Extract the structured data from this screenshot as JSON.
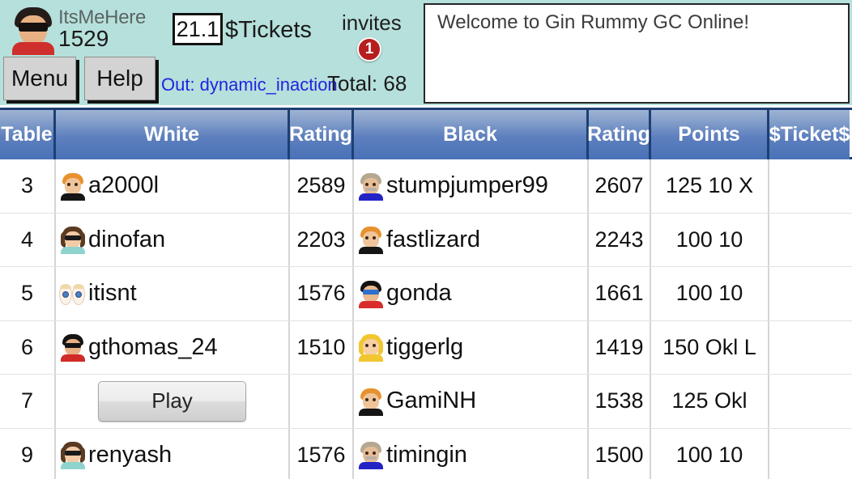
{
  "header": {
    "user": {
      "avatar_icon": "user-avatar-sunglasses-red",
      "name": "ItsMeHere",
      "rating": "1529"
    },
    "tickets": {
      "value": "21.1",
      "label": "$Tickets"
    },
    "invites": {
      "label": "invites",
      "count": "1"
    },
    "buttons": {
      "menu": "Menu",
      "help": "Help"
    },
    "out_status": "Out: dynamic_inaction",
    "total": "Total: 68",
    "chat": {
      "message": "Welcome to Gin Rummy GC Online!"
    }
  },
  "colors": {
    "top_bar_bg": "#b6e0dc",
    "header_row_blue": "#4a72b7",
    "header_row_border": "#1d3f73",
    "link_blue": "#2323e0",
    "badge_red": "#b81d1d"
  },
  "table": {
    "columns": [
      {
        "label": "Table"
      },
      {
        "label": "White"
      },
      {
        "label": "Rating"
      },
      {
        "label": "Black"
      },
      {
        "label": "Rating"
      },
      {
        "label": "Points"
      },
      {
        "label": "$Ticket$"
      }
    ],
    "rows": [
      {
        "table": "3",
        "white": {
          "name": "a2000l",
          "avatar_icon": "avatar-orange-hair-black-shirt"
        },
        "white_rating": "2589",
        "black": {
          "name": "stumpjumper99",
          "avatar_icon": "avatar-grey-hair-moustache-blue-shirt"
        },
        "black_rating": "2607",
        "points": "125 10 X",
        "ticket": ""
      },
      {
        "table": "4",
        "white": {
          "name": "dinofan",
          "avatar_icon": "avatar-brown-curly-sunglasses-teal-shirt"
        },
        "white_rating": "2203",
        "black": {
          "name": "fastlizard",
          "avatar_icon": "avatar-orange-hair-black-shirt"
        },
        "black_rating": "2243",
        "points": "100 10",
        "ticket": ""
      },
      {
        "table": "5",
        "white": {
          "name": "itisnt",
          "avatar_icon": "avatar-big-eyes"
        },
        "white_rating": "1576",
        "black": {
          "name": "gonda",
          "avatar_icon": "avatar-black-hair-blue-glasses-red-shirt"
        },
        "black_rating": "1661",
        "points": "100 10",
        "ticket": ""
      },
      {
        "table": "6",
        "white": {
          "name": "gthomas_24",
          "avatar_icon": "avatar-black-hair-sunglasses-red-shirt"
        },
        "white_rating": "1510",
        "black": {
          "name": "tiggerlg",
          "avatar_icon": "avatar-blonde-long-hair-female"
        },
        "black_rating": "1419",
        "points": "150 Okl L",
        "ticket": ""
      },
      {
        "table": "7",
        "white": {
          "name": "",
          "avatar_icon": "",
          "play_button": "Play"
        },
        "white_rating": "",
        "black": {
          "name": "GamiNH",
          "avatar_icon": "avatar-orange-hair-black-shirt"
        },
        "black_rating": "1538",
        "points": "125 Okl",
        "ticket": ""
      },
      {
        "table": "9",
        "white": {
          "name": "renyash",
          "avatar_icon": "avatar-brown-curly-sunglasses-teal-shirt"
        },
        "white_rating": "1576",
        "black": {
          "name": "timingin",
          "avatar_icon": "avatar-grey-hair-moustache-blue-shirt"
        },
        "black_rating": "1500",
        "points": "100 10",
        "ticket": ""
      }
    ]
  }
}
